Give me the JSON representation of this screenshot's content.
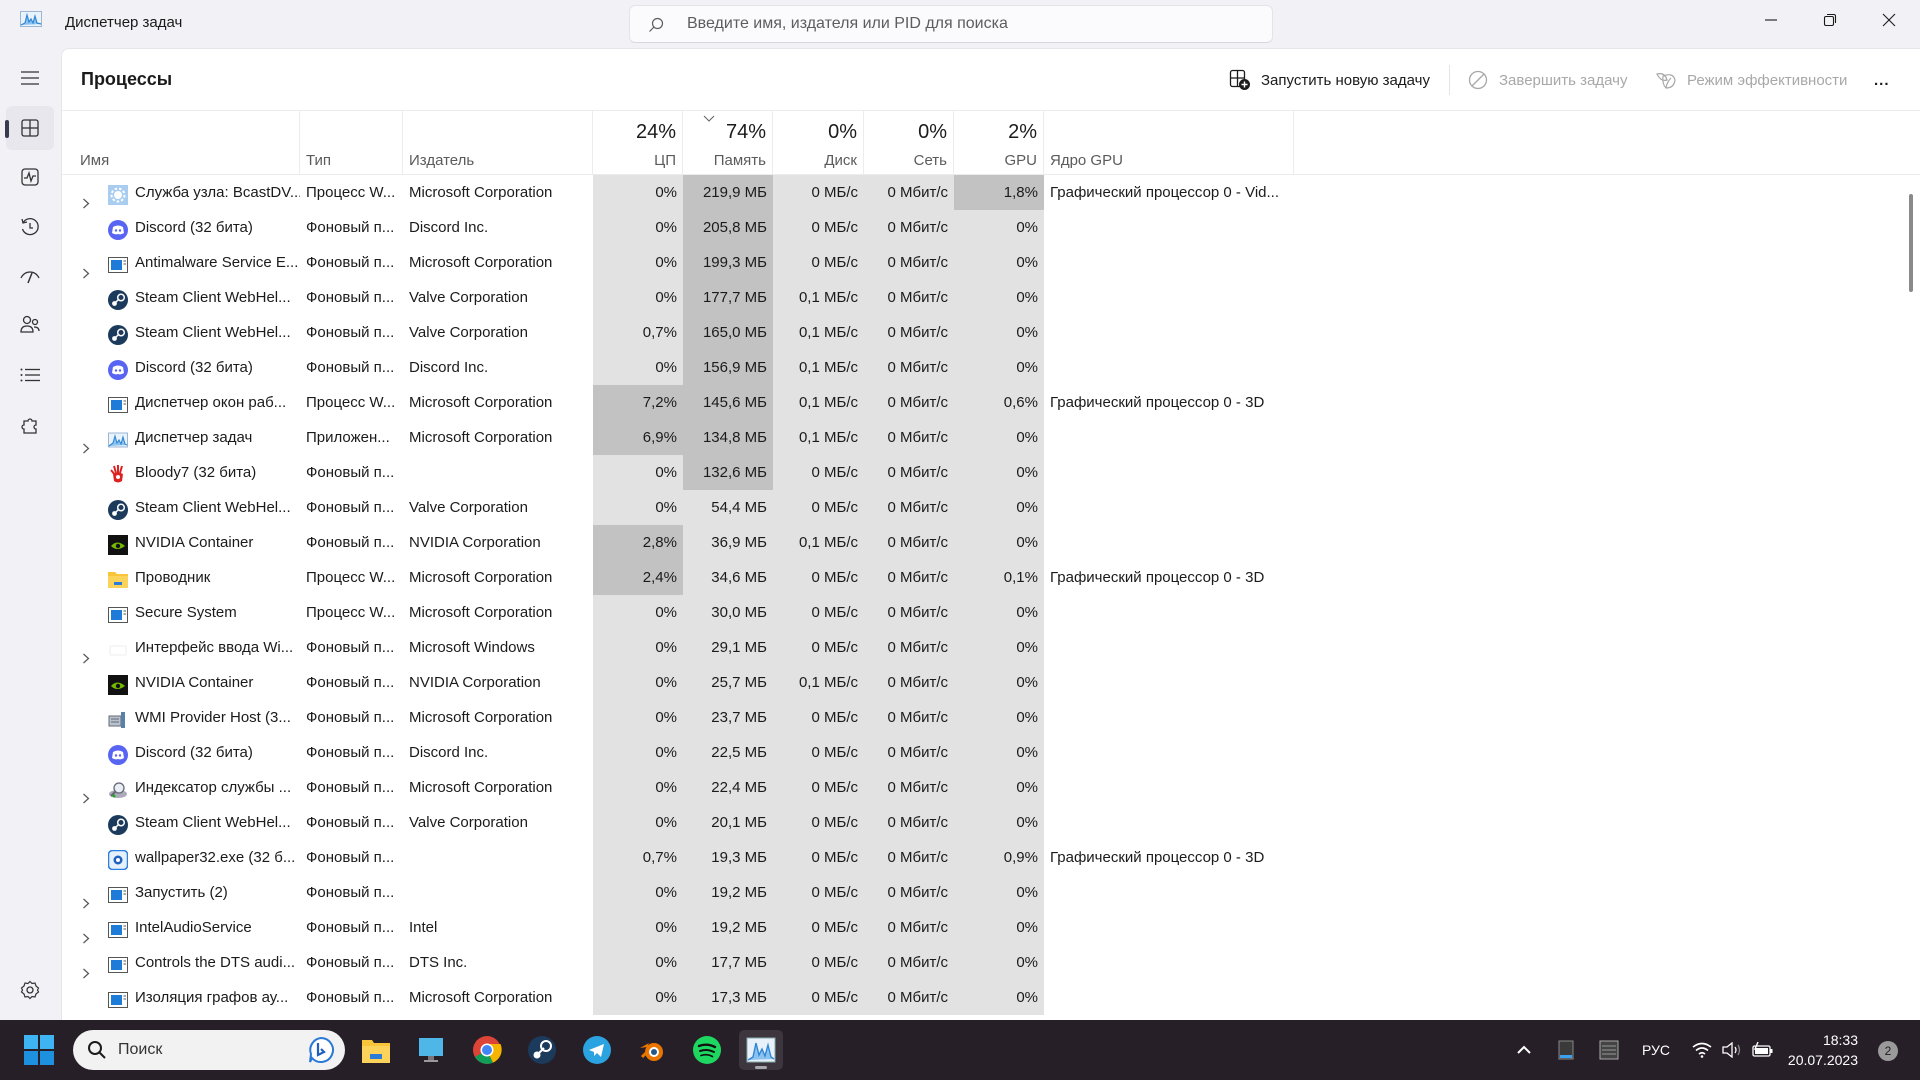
{
  "window": {
    "title": "Диспетчер задач",
    "search_placeholder": "Введите имя, издателя или PID для поиска"
  },
  "nav": {
    "items": [
      {
        "name": "menu",
        "label": "Меню"
      },
      {
        "name": "processes",
        "label": "Процессы",
        "active": true
      },
      {
        "name": "performance",
        "label": "Производительность"
      },
      {
        "name": "app-history",
        "label": "Журнал приложений"
      },
      {
        "name": "startup",
        "label": "Автозагрузка"
      },
      {
        "name": "users",
        "label": "Пользователи"
      },
      {
        "name": "details",
        "label": "Подробности"
      },
      {
        "name": "services",
        "label": "Службы"
      },
      {
        "name": "settings",
        "label": "Параметры"
      }
    ]
  },
  "page": {
    "title": "Процессы",
    "commands": {
      "run_new_task": "Запустить новую задачу",
      "end_task": "Завершить задачу",
      "efficiency_mode": "Режим эффективности",
      "more": "..."
    }
  },
  "table": {
    "columns": {
      "name": "Имя",
      "type": "Тип",
      "publisher": "Издатель",
      "cpu": {
        "label": "ЦП",
        "total": "24%"
      },
      "memory": {
        "label": "Память",
        "total": "74%",
        "sorted": "desc"
      },
      "disk": {
        "label": "Диск",
        "total": "0%"
      },
      "network": {
        "label": "Сеть",
        "total": "0%"
      },
      "gpu": {
        "label": "GPU",
        "total": "2%"
      },
      "gpu_engine": "Ядро GPU"
    },
    "rows": [
      {
        "expand": true,
        "icon": "service-gear",
        "name": "Служба узла: BcastDV...",
        "type": "Процесс W...",
        "publisher": "Microsoft Corporation",
        "cpu": "0%",
        "mem": "219,9 МБ",
        "disk": "0 МБ/с",
        "net": "0 Мбит/с",
        "gpu": "1,8%",
        "engine": "Графический процессор 0 - Vid...",
        "cpu_h": 0,
        "mem_h": 2,
        "disk_h": 0,
        "gpu_h": 2
      },
      {
        "expand": false,
        "icon": "discord",
        "name": "Discord (32 бита)",
        "type": "Фоновый п...",
        "publisher": "Discord Inc.",
        "cpu": "0%",
        "mem": "205,8 МБ",
        "disk": "0 МБ/с",
        "net": "0 Мбит/с",
        "gpu": "0%",
        "engine": "",
        "cpu_h": 0,
        "mem_h": 2,
        "gpu_h": 0
      },
      {
        "expand": true,
        "icon": "window-app",
        "name": "Antimalware Service E...",
        "type": "Фоновый п...",
        "publisher": "Microsoft Corporation",
        "cpu": "0%",
        "mem": "199,3 МБ",
        "disk": "0 МБ/с",
        "net": "0 Мбит/с",
        "gpu": "0%",
        "engine": "",
        "cpu_h": 0,
        "mem_h": 2,
        "gpu_h": 0
      },
      {
        "expand": false,
        "icon": "steam",
        "name": "Steam Client WebHel...",
        "type": "Фоновый п...",
        "publisher": "Valve Corporation",
        "cpu": "0%",
        "mem": "177,7 МБ",
        "disk": "0,1 МБ/с",
        "net": "0 Мбит/с",
        "gpu": "0%",
        "engine": "",
        "cpu_h": 0,
        "mem_h": 2,
        "gpu_h": 0
      },
      {
        "expand": false,
        "icon": "steam",
        "name": "Steam Client WebHel...",
        "type": "Фоновый п...",
        "publisher": "Valve Corporation",
        "cpu": "0,7%",
        "mem": "165,0 МБ",
        "disk": "0,1 МБ/с",
        "net": "0 Мбит/с",
        "gpu": "0%",
        "engine": "",
        "cpu_h": 0,
        "mem_h": 2,
        "gpu_h": 0
      },
      {
        "expand": false,
        "icon": "discord",
        "name": "Discord (32 бита)",
        "type": "Фоновый п...",
        "publisher": "Discord Inc.",
        "cpu": "0%",
        "mem": "156,9 МБ",
        "disk": "0,1 МБ/с",
        "net": "0 Мбит/с",
        "gpu": "0%",
        "engine": "",
        "cpu_h": 0,
        "mem_h": 2,
        "gpu_h": 0
      },
      {
        "expand": false,
        "icon": "window-app",
        "name": "Диспетчер окон раб...",
        "type": "Процесс W...",
        "publisher": "Microsoft Corporation",
        "cpu": "7,2%",
        "mem": "145,6 МБ",
        "disk": "0,1 МБ/с",
        "net": "0 Мбит/с",
        "gpu": "0,6%",
        "engine": "Графический процессор 0 - 3D",
        "cpu_h": 2,
        "mem_h": 2,
        "gpu_h": 0
      },
      {
        "expand": true,
        "icon": "taskmgr",
        "name": "Диспетчер задач",
        "type": "Приложен...",
        "publisher": "Microsoft Corporation",
        "cpu": "6,9%",
        "mem": "134,8 МБ",
        "disk": "0,1 МБ/с",
        "net": "0 Мбит/с",
        "gpu": "0%",
        "engine": "",
        "cpu_h": 2,
        "mem_h": 2,
        "gpu_h": 0
      },
      {
        "expand": false,
        "icon": "bloody",
        "name": "Bloody7 (32 бита)",
        "type": "Фоновый п...",
        "publisher": "",
        "cpu": "0%",
        "mem": "132,6 МБ",
        "disk": "0 МБ/с",
        "net": "0 Мбит/с",
        "gpu": "0%",
        "engine": "",
        "cpu_h": 0,
        "mem_h": 2,
        "gpu_h": 0
      },
      {
        "expand": false,
        "icon": "steam",
        "name": "Steam Client WebHel...",
        "type": "Фоновый п...",
        "publisher": "Valve Corporation",
        "cpu": "0%",
        "mem": "54,4 МБ",
        "disk": "0 МБ/с",
        "net": "0 Мбит/с",
        "gpu": "0%",
        "engine": "",
        "cpu_h": 0,
        "mem_h": 1,
        "gpu_h": 0
      },
      {
        "expand": false,
        "icon": "nvidia",
        "name": "NVIDIA Container",
        "type": "Фоновый п...",
        "publisher": "NVIDIA Corporation",
        "cpu": "2,8%",
        "mem": "36,9 МБ",
        "disk": "0,1 МБ/с",
        "net": "0 Мбит/с",
        "gpu": "0%",
        "engine": "",
        "cpu_h": 2,
        "mem_h": 1,
        "gpu_h": 0
      },
      {
        "expand": false,
        "icon": "explorer",
        "name": "Проводник",
        "type": "Процесс W...",
        "publisher": "Microsoft Corporation",
        "cpu": "2,4%",
        "mem": "34,6 МБ",
        "disk": "0 МБ/с",
        "net": "0 Мбит/с",
        "gpu": "0,1%",
        "engine": "Графический процессор 0 - 3D",
        "cpu_h": 2,
        "mem_h": 1,
        "gpu_h": 0
      },
      {
        "expand": false,
        "icon": "window-app",
        "name": "Secure System",
        "type": "Процесс W...",
        "publisher": "Microsoft Corporation",
        "cpu": "0%",
        "mem": "30,0 МБ",
        "disk": "0 МБ/с",
        "net": "0 Мбит/с",
        "gpu": "0%",
        "engine": "",
        "cpu_h": 0,
        "mem_h": 1,
        "gpu_h": 0
      },
      {
        "expand": true,
        "icon": "blank",
        "name": "Интерфейс ввода Wi...",
        "type": "Фоновый п...",
        "publisher": "Microsoft Windows",
        "cpu": "0%",
        "mem": "29,1 МБ",
        "disk": "0 МБ/с",
        "net": "0 Мбит/с",
        "gpu": "0%",
        "engine": "",
        "cpu_h": 0,
        "mem_h": 1,
        "gpu_h": 0
      },
      {
        "expand": false,
        "icon": "nvidia",
        "name": "NVIDIA Container",
        "type": "Фоновый п...",
        "publisher": "NVIDIA Corporation",
        "cpu": "0%",
        "mem": "25,7 МБ",
        "disk": "0,1 МБ/с",
        "net": "0 Мбит/с",
        "gpu": "0%",
        "engine": "",
        "cpu_h": 0,
        "mem_h": 1,
        "gpu_h": 0
      },
      {
        "expand": false,
        "icon": "wmi",
        "name": "WMI Provider Host (3...",
        "type": "Фоновый п...",
        "publisher": "Microsoft Corporation",
        "cpu": "0%",
        "mem": "23,7 МБ",
        "disk": "0 МБ/с",
        "net": "0 Мбит/с",
        "gpu": "0%",
        "engine": "",
        "cpu_h": 0,
        "mem_h": 1,
        "gpu_h": 0
      },
      {
        "expand": false,
        "icon": "discord",
        "name": "Discord (32 бита)",
        "type": "Фоновый п...",
        "publisher": "Discord Inc.",
        "cpu": "0%",
        "mem": "22,5 МБ",
        "disk": "0 МБ/с",
        "net": "0 Мбит/с",
        "gpu": "0%",
        "engine": "",
        "cpu_h": 0,
        "mem_h": 1,
        "gpu_h": 0
      },
      {
        "expand": true,
        "icon": "indexer",
        "name": "Индексатор службы ...",
        "type": "Фоновый п...",
        "publisher": "Microsoft Corporation",
        "cpu": "0%",
        "mem": "22,4 МБ",
        "disk": "0 МБ/с",
        "net": "0 Мбит/с",
        "gpu": "0%",
        "engine": "",
        "cpu_h": 0,
        "mem_h": 1,
        "gpu_h": 0
      },
      {
        "expand": false,
        "icon": "steam",
        "name": "Steam Client WebHel...",
        "type": "Фоновый п...",
        "publisher": "Valve Corporation",
        "cpu": "0%",
        "mem": "20,1 МБ",
        "disk": "0 МБ/с",
        "net": "0 Мбит/с",
        "gpu": "0%",
        "engine": "",
        "cpu_h": 0,
        "mem_h": 1,
        "gpu_h": 0
      },
      {
        "expand": false,
        "icon": "wallpaper",
        "name": "wallpaper32.exe (32 б...",
        "type": "Фоновый п...",
        "publisher": "",
        "cpu": "0,7%",
        "mem": "19,3 МБ",
        "disk": "0 МБ/с",
        "net": "0 Мбит/с",
        "gpu": "0,9%",
        "engine": "Графический процессор 0 - 3D",
        "cpu_h": 1,
        "mem_h": 1,
        "gpu_h": 0
      },
      {
        "expand": true,
        "icon": "window-app",
        "name": "Запустить (2)",
        "type": "Фоновый п...",
        "publisher": "",
        "cpu": "0%",
        "mem": "19,2 МБ",
        "disk": "0 МБ/с",
        "net": "0 Мбит/с",
        "gpu": "0%",
        "engine": "",
        "cpu_h": 0,
        "mem_h": 1,
        "gpu_h": 0
      },
      {
        "expand": true,
        "icon": "window-app",
        "name": "IntelAudioService",
        "type": "Фоновый п...",
        "publisher": "Intel",
        "cpu": "0%",
        "mem": "19,2 МБ",
        "disk": "0 МБ/с",
        "net": "0 Мбит/с",
        "gpu": "0%",
        "engine": "",
        "cpu_h": 0,
        "mem_h": 1,
        "gpu_h": 0
      },
      {
        "expand": true,
        "icon": "window-app",
        "name": "Controls the DTS audi...",
        "type": "Фоновый п...",
        "publisher": "DTS Inc.",
        "cpu": "0%",
        "mem": "17,7 МБ",
        "disk": "0 МБ/с",
        "net": "0 Мбит/с",
        "gpu": "0%",
        "engine": "",
        "cpu_h": 0,
        "mem_h": 1,
        "gpu_h": 0
      },
      {
        "expand": false,
        "icon": "window-app",
        "name": "Изоляция графов ау...",
        "type": "Фоновый п...",
        "publisher": "Microsoft Corporation",
        "cpu": "0%",
        "mem": "17,3 МБ",
        "disk": "0 МБ/с",
        "net": "0 Мбит/с",
        "gpu": "0%",
        "engine": "",
        "cpu_h": 0,
        "mem_h": 1,
        "gpu_h": 0
      }
    ]
  },
  "taskbar": {
    "search_placeholder": "Поиск",
    "apps": [
      "file-explorer",
      "this-pc",
      "chrome",
      "steam",
      "telegram",
      "blender",
      "spotify",
      "task-manager"
    ],
    "active_app": "task-manager",
    "language": "РУС",
    "time": "18:33",
    "date": "20.07.2023",
    "notifications": "2"
  },
  "colors": {
    "heat_light": "#e2e2e2",
    "heat_dark": "#c3c2c2",
    "taskbar_bg": "#261f27",
    "window_bg": "#f2f1f6"
  }
}
